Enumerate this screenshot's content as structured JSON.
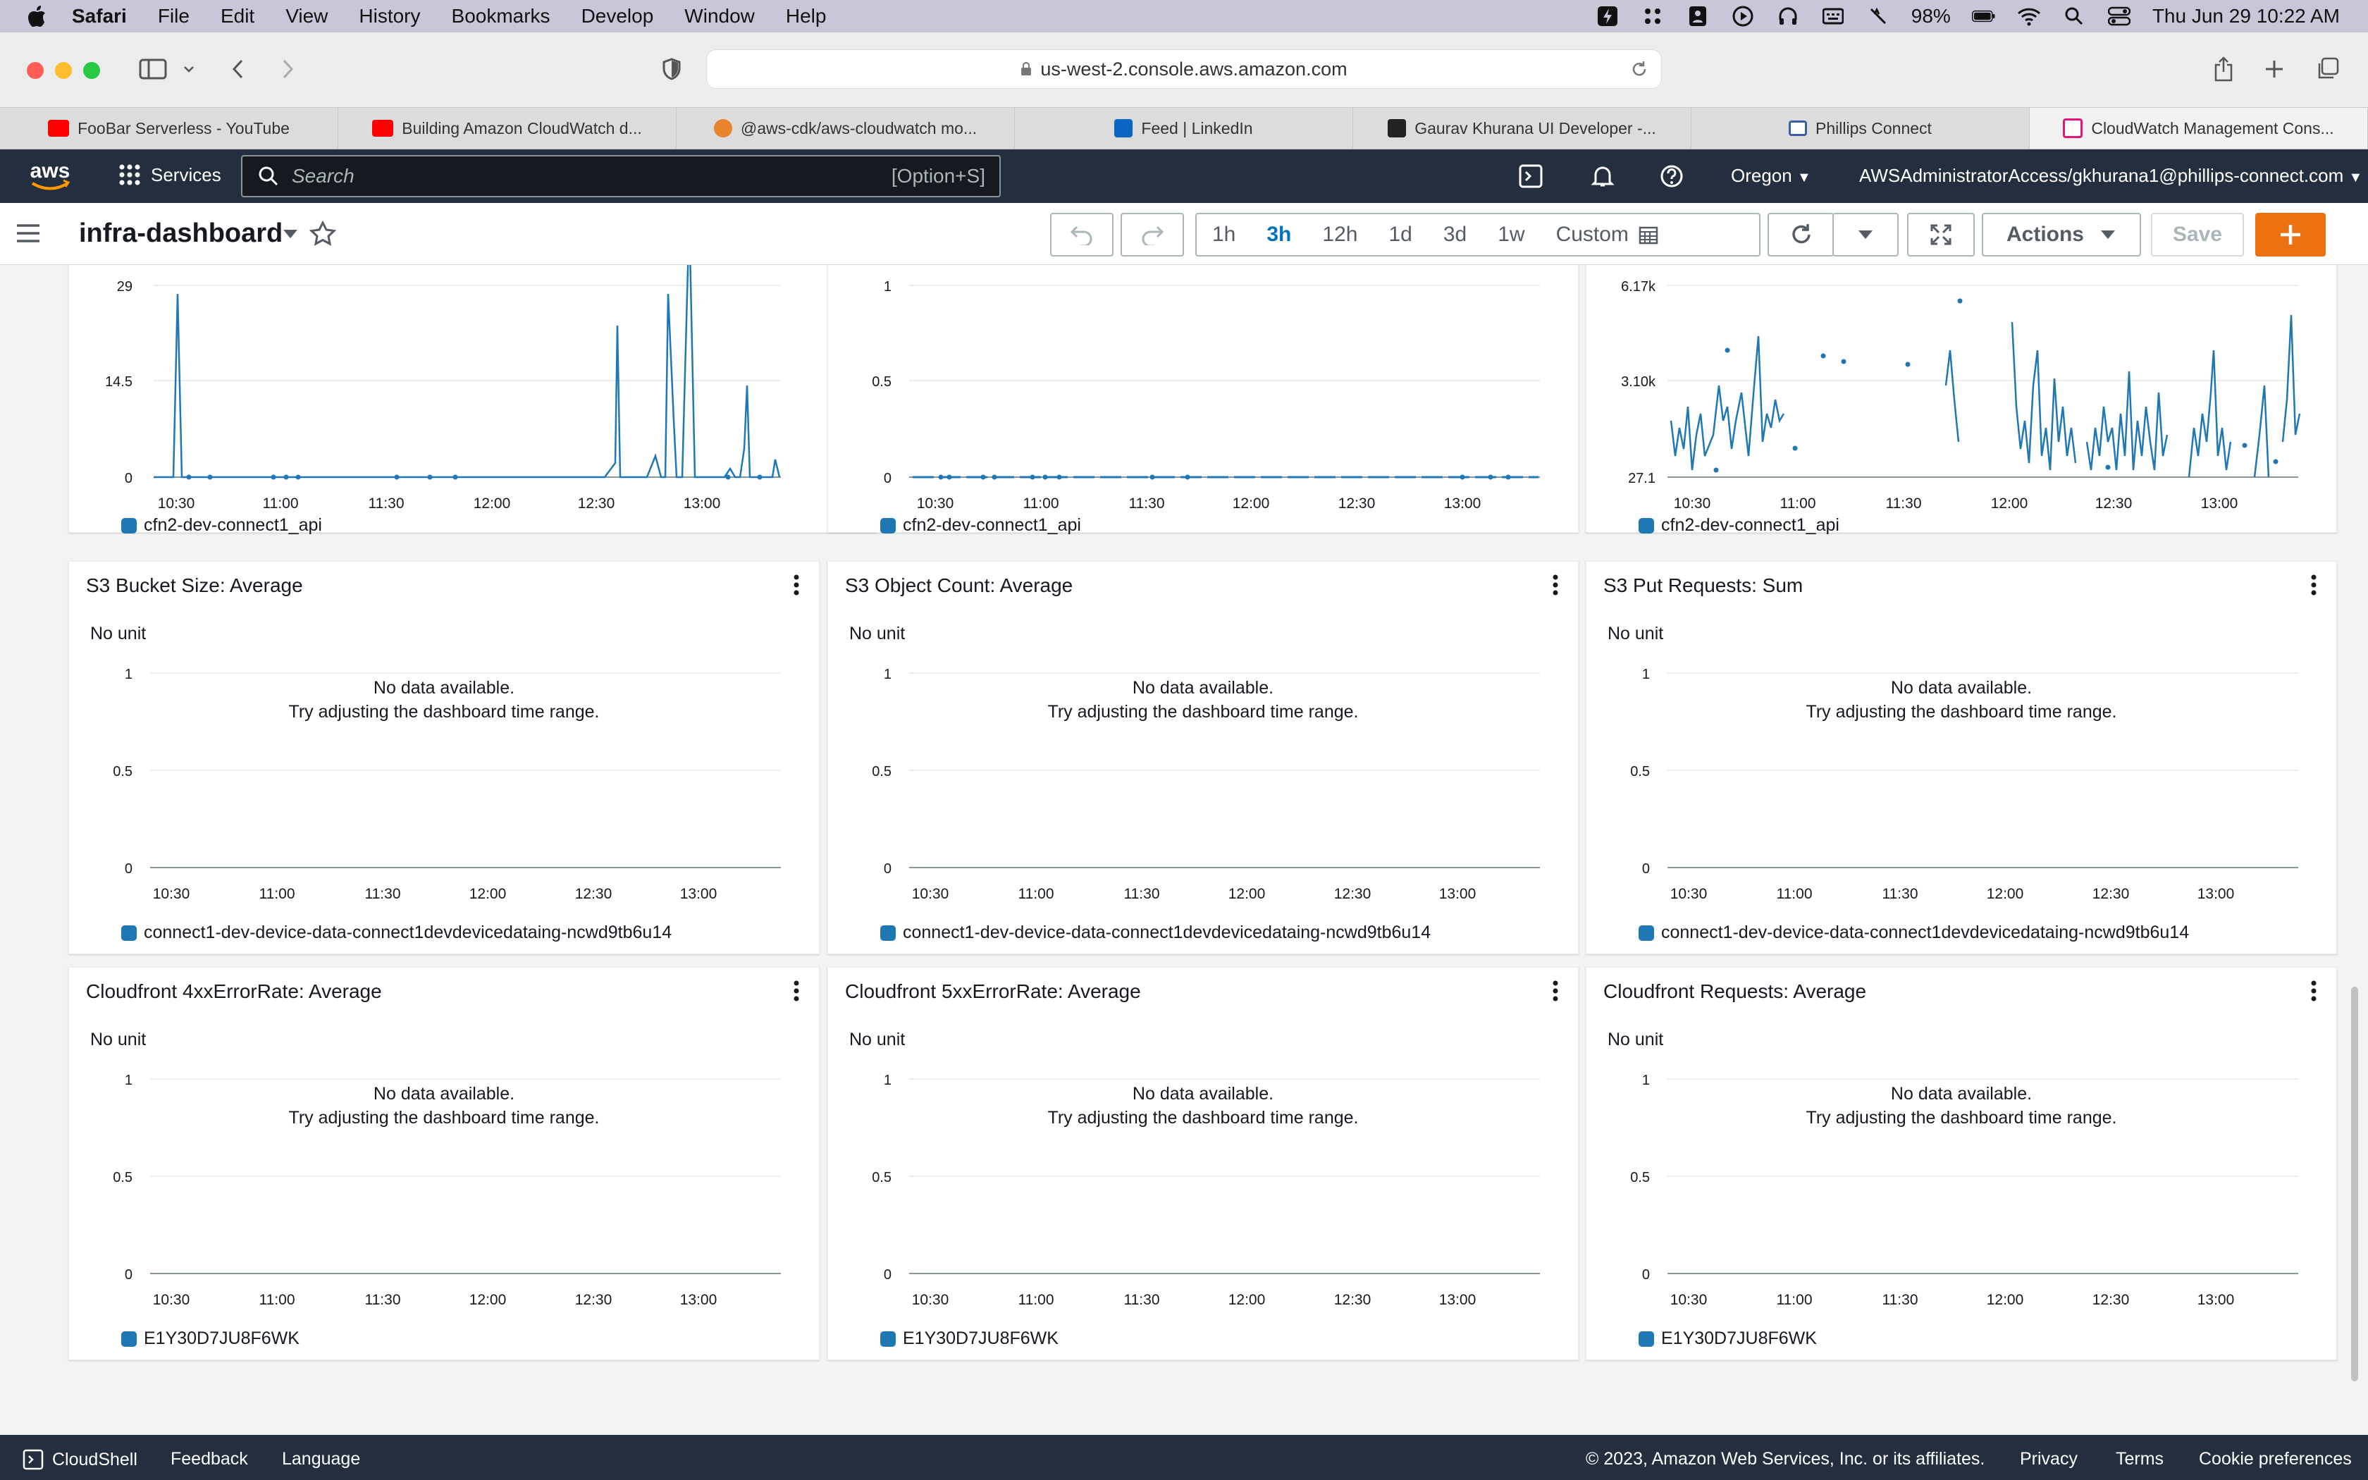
{
  "menubar": {
    "items": [
      "Safari",
      "File",
      "Edit",
      "View",
      "History",
      "Bookmarks",
      "Develop",
      "Window",
      "Help"
    ],
    "battery": "98%",
    "datetime": "Thu Jun 29  10:22 AM"
  },
  "safari": {
    "url": "us-west-2.console.aws.amazon.com"
  },
  "tabs": [
    {
      "label": "FooBar Serverless - YouTube",
      "icon": "youtube-icon",
      "color": "#ff0000"
    },
    {
      "label": "Building Amazon CloudWatch d...",
      "icon": "youtube-icon",
      "color": "#ff0000"
    },
    {
      "label": "@aws-cdk/aws-cloudwatch mo...",
      "icon": "package-icon",
      "color": "#e8842c"
    },
    {
      "label": "Feed | LinkedIn",
      "icon": "linkedin-icon",
      "color": "#0a66c2"
    },
    {
      "label": "Gaurav Khurana UI Developer -...",
      "icon": "terminal-icon",
      "color": "#222222"
    },
    {
      "label": "Phillips Connect",
      "icon": "shield-icon",
      "color": "#3b5fa0"
    },
    {
      "label": "CloudWatch Management Cons...",
      "icon": "cloudwatch-icon",
      "color": "#e7157b"
    }
  ],
  "awsnav": {
    "logo": "aws",
    "services": "Services",
    "search_placeholder": "Search",
    "search_hint": "[Option+S]",
    "region": "Oregon",
    "account": "AWSAdministratorAccess/gkhurana1@phillips-connect.com"
  },
  "dashboard": {
    "title": "infra-dashboard",
    "time_ranges": [
      "1h",
      "3h",
      "12h",
      "1d",
      "3d",
      "1w"
    ],
    "selected_range": "3h",
    "custom_label": "Custom",
    "actions_label": "Actions",
    "save_label": "Save",
    "add_label": "+"
  },
  "time_ticks": [
    "10:30",
    "11:00",
    "11:30",
    "12:00",
    "12:30",
    "13:00"
  ],
  "widgets_top": [
    {
      "legend": "cfn2-dev-connect1_api",
      "y_ticks": [
        "29",
        "14.5",
        "0"
      ]
    },
    {
      "legend": "cfn2-dev-connect1_api",
      "y_ticks": [
        "1",
        "0.5",
        "0"
      ]
    },
    {
      "legend": "cfn2-dev-connect1_api",
      "y_ticks": [
        "6.17k",
        "3.10k",
        "27.1"
      ]
    }
  ],
  "widgets": [
    {
      "title": "S3 Bucket Size: Average",
      "unit": "No unit",
      "nodata1": "No data available.",
      "nodata2": "Try adjusting the dashboard time range.",
      "legend": "connect1-dev-device-data-connect1devdevicedataing-ncwd9tb6u14",
      "y_ticks": [
        "1",
        "0.5",
        "0"
      ]
    },
    {
      "title": "S3 Object Count: Average",
      "unit": "No unit",
      "nodata1": "No data available.",
      "nodata2": "Try adjusting the dashboard time range.",
      "legend": "connect1-dev-device-data-connect1devdevicedataing-ncwd9tb6u14",
      "y_ticks": [
        "1",
        "0.5",
        "0"
      ]
    },
    {
      "title": "S3 Put Requests: Sum",
      "unit": "No unit",
      "nodata1": "No data available.",
      "nodata2": "Try adjusting the dashboard time range.",
      "legend": "connect1-dev-device-data-connect1devdevicedataing-ncwd9tb6u14",
      "y_ticks": [
        "1",
        "0.5",
        "0"
      ]
    },
    {
      "title": "Cloudfront 4xxErrorRate: Average",
      "unit": "No unit",
      "nodata1": "No data available.",
      "nodata2": "Try adjusting the dashboard time range.",
      "legend": "E1Y30D7JU8F6WK",
      "y_ticks": [
        "1",
        "0.5",
        "0"
      ]
    },
    {
      "title": "Cloudfront 5xxErrorRate: Average",
      "unit": "No unit",
      "nodata1": "No data available.",
      "nodata2": "Try adjusting the dashboard time range.",
      "legend": "E1Y30D7JU8F6WK",
      "y_ticks": [
        "1",
        "0.5",
        "0"
      ]
    },
    {
      "title": "Cloudfront Requests: Average",
      "unit": "No unit",
      "nodata1": "No data available.",
      "nodata2": "Try adjusting the dashboard time range.",
      "legend": "E1Y30D7JU8F6WK",
      "y_ticks": [
        "1",
        "0.5",
        "0"
      ]
    }
  ],
  "footer": {
    "cloudshell": "CloudShell",
    "feedback": "Feedback",
    "language": "Language",
    "copyright": "© 2023, Amazon Web Services, Inc. or its affiliates.",
    "privacy": "Privacy",
    "terms": "Terms",
    "cookies": "Cookie preferences"
  },
  "colors": {
    "aws_nav": "#232f3e",
    "accent_orange": "#ec7211",
    "selected_blue": "#0073bb",
    "series_blue": "#1f77b4"
  }
}
